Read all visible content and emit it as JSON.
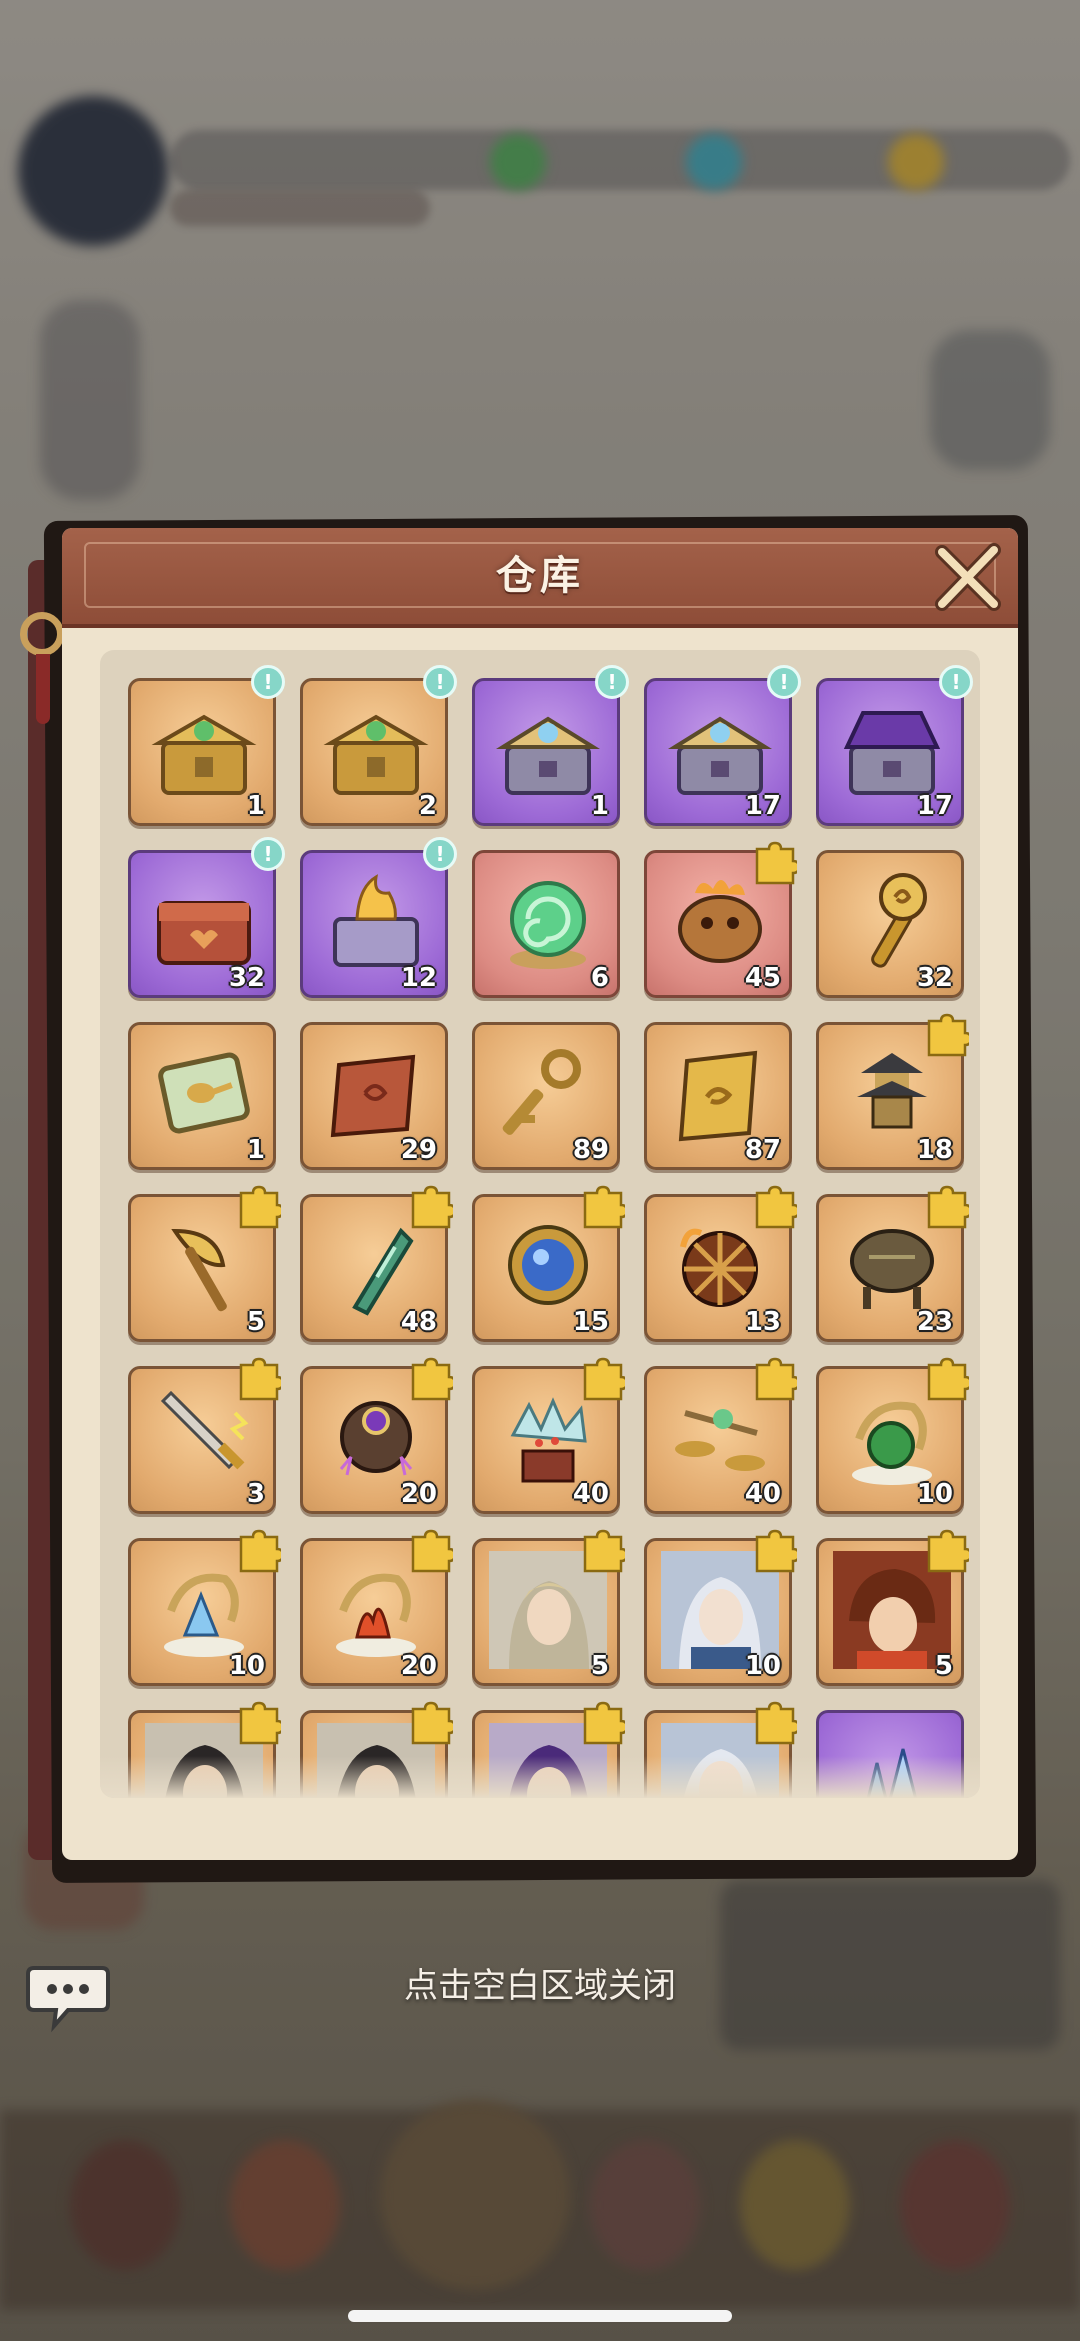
{
  "dialog": {
    "title": "仓库",
    "close_icon": "close-x-icon"
  },
  "hint": "点击空白区域关闭",
  "colors": {
    "header": "#8e4d38",
    "panel": "#eee3cd",
    "slot_orange": "#e2aa6e",
    "slot_purple": "#9d6ad6",
    "slot_red": "#dc8b83",
    "badge": "#86d6c8",
    "fragment": "#f1c640"
  },
  "items": [
    {
      "name": "treasure-chest-green-gem",
      "count": "1",
      "rarity": "orange",
      "mark": "notice",
      "icon": "chest-gold"
    },
    {
      "name": "treasure-chest-puzzle",
      "count": "2",
      "rarity": "orange",
      "mark": "notice",
      "icon": "chest-gold"
    },
    {
      "name": "treasure-chest-blue-gem",
      "count": "1",
      "rarity": "purple",
      "mark": "notice",
      "icon": "chest-silver"
    },
    {
      "name": "treasure-chest-blue-gem-2",
      "count": "17",
      "rarity": "purple",
      "mark": "notice",
      "icon": "chest-silver"
    },
    {
      "name": "treasure-chest-purple-puzzle",
      "count": "17",
      "rarity": "purple",
      "mark": "notice",
      "icon": "chest-purple"
    },
    {
      "name": "red-heart-chest",
      "count": "32",
      "rarity": "purple",
      "mark": "notice",
      "icon": "chest-red"
    },
    {
      "name": "flame-chest",
      "count": "12",
      "rarity": "purple",
      "mark": "notice",
      "icon": "chest-flame"
    },
    {
      "name": "green-vortex-orb",
      "count": "6",
      "rarity": "red",
      "mark": "none",
      "icon": "vortex"
    },
    {
      "name": "demon-mask-cauldron",
      "count": "45",
      "rarity": "red",
      "mark": "fragment",
      "icon": "cauldron-fire"
    },
    {
      "name": "golden-scepter",
      "count": "32",
      "rarity": "orange",
      "mark": "none",
      "icon": "scepter"
    },
    {
      "name": "jade-spoon-tablet",
      "count": "1",
      "rarity": "orange",
      "mark": "none",
      "icon": "tablet"
    },
    {
      "name": "red-scroll",
      "count": "29",
      "rarity": "orange",
      "mark": "none",
      "icon": "scroll"
    },
    {
      "name": "bronze-key",
      "count": "89",
      "rarity": "orange",
      "mark": "none",
      "icon": "key"
    },
    {
      "name": "gold-ticket",
      "count": "87",
      "rarity": "orange",
      "mark": "none",
      "icon": "ticket"
    },
    {
      "name": "pagoda-fragment",
      "count": "18",
      "rarity": "orange",
      "mark": "fragment",
      "icon": "pagoda"
    },
    {
      "name": "golden-axe-fragment",
      "count": "5",
      "rarity": "orange",
      "mark": "fragment",
      "icon": "axe"
    },
    {
      "name": "jade-blade-fragment",
      "count": "48",
      "rarity": "orange",
      "mark": "fragment",
      "icon": "blade"
    },
    {
      "name": "sapphire-mirror-fragment",
      "count": "15",
      "rarity": "orange",
      "mark": "fragment",
      "icon": "mirror"
    },
    {
      "name": "fire-wheel-fragment",
      "count": "13",
      "rarity": "orange",
      "mark": "fragment",
      "icon": "wheel"
    },
    {
      "name": "bronze-ding-fragment",
      "count": "23",
      "rarity": "orange",
      "mark": "fragment",
      "icon": "ding"
    },
    {
      "name": "lightning-sword-fragment",
      "count": "3",
      "rarity": "orange",
      "mark": "fragment",
      "icon": "sword"
    },
    {
      "name": "dark-amulet-fragment",
      "count": "20",
      "rarity": "orange",
      "mark": "fragment",
      "icon": "amulet"
    },
    {
      "name": "crystal-bonsai-fragment",
      "count": "40",
      "rarity": "orange",
      "mark": "fragment",
      "icon": "bonsai"
    },
    {
      "name": "jade-scale-fragment",
      "count": "40",
      "rarity": "orange",
      "mark": "fragment",
      "icon": "scale"
    },
    {
      "name": "dragon-jade-disc-fragment",
      "count": "10",
      "rarity": "orange",
      "mark": "fragment",
      "icon": "dragon-green"
    },
    {
      "name": "dragon-ice-fragment",
      "count": "10",
      "rarity": "orange",
      "mark": "fragment",
      "icon": "dragon-blue"
    },
    {
      "name": "dragon-fire-fragment",
      "count": "20",
      "rarity": "orange",
      "mark": "fragment",
      "icon": "dragon-red"
    },
    {
      "name": "hero-portrait-scholar",
      "count": "5",
      "rarity": "orange",
      "mark": "fragment",
      "icon": "portrait-blond"
    },
    {
      "name": "hero-portrait-silver",
      "count": "10",
      "rarity": "orange",
      "mark": "fragment",
      "icon": "portrait-silver"
    },
    {
      "name": "hero-portrait-youth",
      "count": "5",
      "rarity": "orange",
      "mark": "fragment",
      "icon": "portrait-brown"
    },
    {
      "name": "hero-portrait-dark",
      "count": "",
      "rarity": "orange",
      "mark": "fragment",
      "icon": "portrait-dark"
    },
    {
      "name": "hero-portrait-dark-2",
      "count": "",
      "rarity": "orange",
      "mark": "fragment",
      "icon": "portrait-dark"
    },
    {
      "name": "hero-portrait-violet",
      "count": "",
      "rarity": "orange",
      "mark": "fragment",
      "icon": "portrait-violet"
    },
    {
      "name": "hero-portrait-elder",
      "count": "",
      "rarity": "orange",
      "mark": "fragment",
      "icon": "portrait-silver"
    },
    {
      "name": "blue-crystal",
      "count": "",
      "rarity": "purple",
      "mark": "none",
      "icon": "crystal"
    }
  ]
}
